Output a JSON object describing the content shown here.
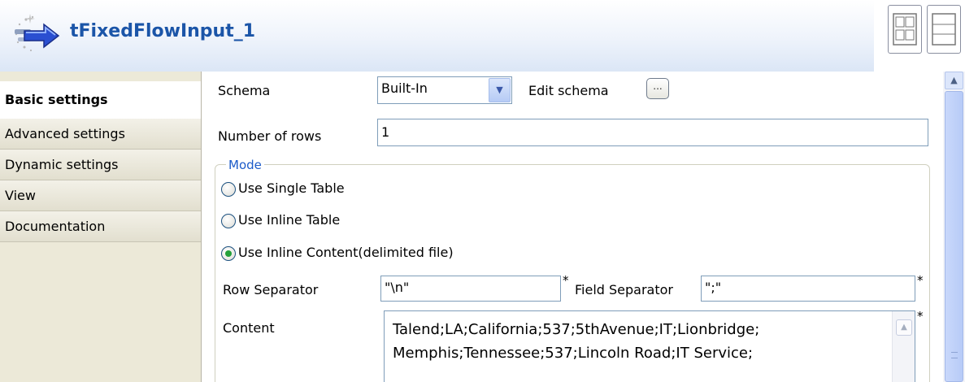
{
  "header": {
    "title": "tFixedFlowInput_1",
    "icon": "component-arrow-icon",
    "layout_buttons": [
      "grid-layout-icon",
      "list-layout-icon"
    ]
  },
  "tabs": [
    {
      "label": "Basic settings",
      "active": true
    },
    {
      "label": "Advanced settings",
      "active": false
    },
    {
      "label": "Dynamic settings",
      "active": false
    },
    {
      "label": "View",
      "active": false
    },
    {
      "label": "Documentation",
      "active": false
    }
  ],
  "schema": {
    "label": "Schema",
    "value": "Built-In",
    "edit_label": "Edit schema",
    "edit_button": "..."
  },
  "rows": {
    "label": "Number of rows",
    "value": "1"
  },
  "mode": {
    "title": "Mode",
    "options": [
      {
        "label": "Use Single Table",
        "checked": false
      },
      {
        "label": "Use Inline Table",
        "checked": false
      },
      {
        "label": "Use Inline Content(delimited file)",
        "checked": true
      }
    ]
  },
  "inline": {
    "row_separator_label": "Row Separator",
    "row_separator_value": "\"\\n\"",
    "field_separator_label": "Field Separator",
    "field_separator_value": "\";\"",
    "required_mark": "*",
    "content_label": "Content",
    "content_lines": [
      "Talend;LA;California;537;5thAvenue;IT;Lionbridge;",
      "Memphis;Tennessee;537;Lincoln Road;IT Service;"
    ]
  },
  "colors": {
    "title": "#1b55a8",
    "group_title": "#1c5bc9",
    "radio_checked": "#23a03a"
  }
}
